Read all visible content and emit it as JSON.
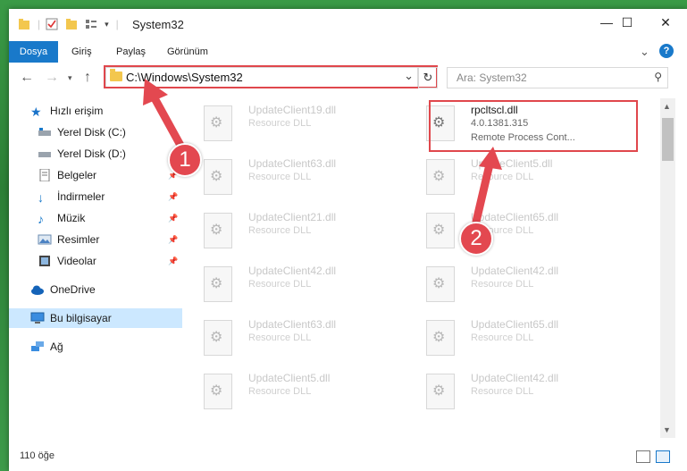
{
  "window": {
    "title": "System32",
    "controls": {
      "minimize": "—",
      "maximize": "☐",
      "close": "✕"
    }
  },
  "ribbon": {
    "tabs": [
      "Dosya",
      "Giriş",
      "Paylaş",
      "Görünüm"
    ],
    "expand": "⌄",
    "help": "?"
  },
  "addressbar": {
    "path": "C:\\Windows\\System32",
    "dropdown": "⌄",
    "refresh": "↻"
  },
  "search": {
    "placeholder": "Ara: System32",
    "icon": "search-icon"
  },
  "navpane": {
    "items": [
      {
        "label": "Hızlı erişim",
        "icon": "star-icon"
      },
      {
        "label": "Yerel Disk (C:)",
        "icon": "drive-icon"
      },
      {
        "label": "Yerel Disk (D:)",
        "icon": "drive-icon"
      },
      {
        "label": "Belgeler",
        "icon": "documents-icon"
      },
      {
        "label": "İndirmeler",
        "icon": "download-icon"
      },
      {
        "label": "Müzik",
        "icon": "music-icon"
      },
      {
        "label": "Resimler",
        "icon": "pictures-icon"
      },
      {
        "label": "Videolar",
        "icon": "video-icon"
      },
      {
        "label": "OneDrive",
        "icon": "cloud-icon"
      },
      {
        "label": "Bu bilgisayar",
        "icon": "computer-icon"
      },
      {
        "label": "Ağ",
        "icon": "network-icon"
      }
    ]
  },
  "files": {
    "left_column": [
      {
        "name": "UpdateClient19.dll",
        "type": "Resource DLL"
      },
      {
        "name": "UpdateClient63.dll",
        "type": "Resource DLL"
      },
      {
        "name": "UpdateClient21.dll",
        "type": "Resource DLL"
      },
      {
        "name": "UpdateClient42.dll",
        "type": "Resource DLL"
      },
      {
        "name": "UpdateClient63.dll",
        "type": "Resource DLL"
      },
      {
        "name": "UpdateClient5.dll",
        "type": "Resource DLL"
      }
    ],
    "right_column": [
      {
        "name": "rpcltscl.dll",
        "type": "4.0.1381.315",
        "desc": "Remote Process Cont..."
      },
      {
        "name": "UpdateClient5.dll",
        "type": "Resource DLL"
      },
      {
        "name": "UpdateClient65.dll",
        "type": "Resource DLL"
      },
      {
        "name": "UpdateClient42.dll",
        "type": "Resource DLL"
      },
      {
        "name": "UpdateClient65.dll",
        "type": "Resource DLL"
      },
      {
        "name": "UpdateClient42.dll",
        "type": "Resource DLL"
      }
    ]
  },
  "status": {
    "count": "110 öğe"
  },
  "annotations": {
    "step1": "1",
    "step2": "2",
    "color": "#e34850"
  }
}
